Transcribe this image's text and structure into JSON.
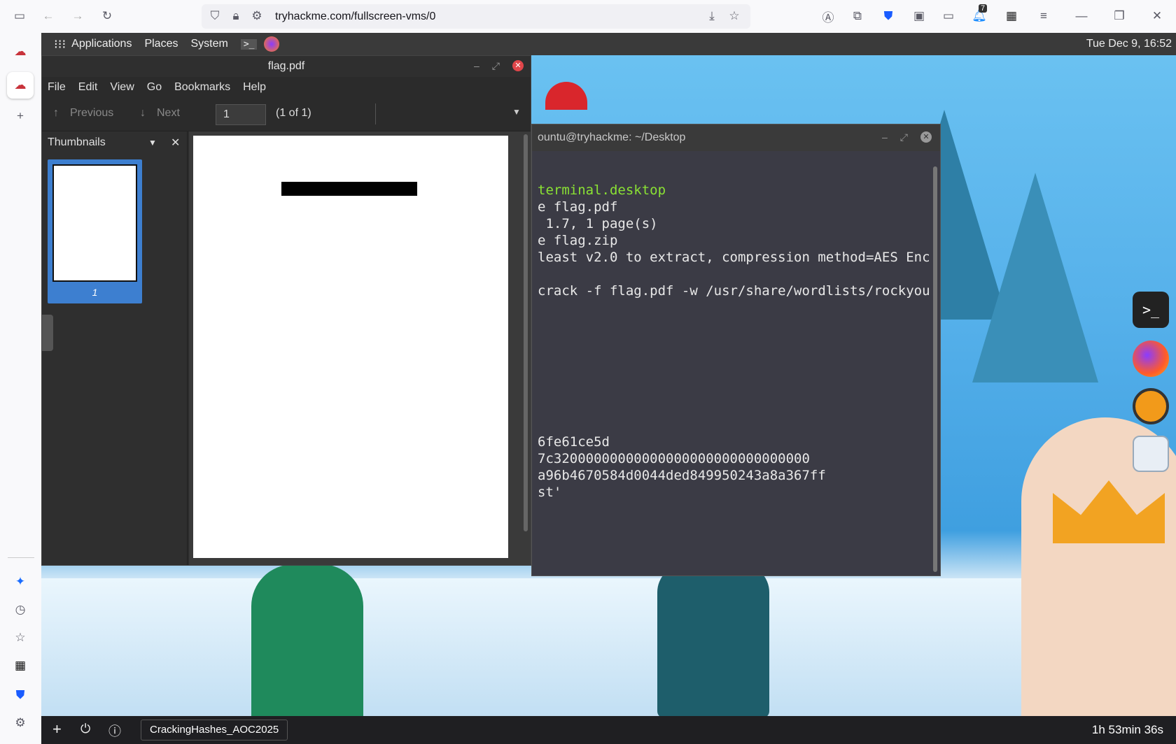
{
  "browser": {
    "url": "tryhackme.com/fullscreen-vms/0",
    "notification_count": "7"
  },
  "gnome_panel": {
    "applications": "Applications",
    "places": "Places",
    "system": "System",
    "clock": "Tue Dec 9, 16:52"
  },
  "pdf_viewer": {
    "title": "flag.pdf",
    "menu": [
      "File",
      "Edit",
      "View",
      "Go",
      "Bookmarks",
      "Help"
    ],
    "previous": "Previous",
    "next": "Next",
    "page_value": "1",
    "page_count": "(1 of 1)",
    "thumbnails_label": "Thumbnails",
    "thumb_page_number": "1"
  },
  "terminal": {
    "title": "ountu@tryhackme: ~/Desktop",
    "lines": [
      "terminal.desktop",
      "e flag.pdf",
      " 1.7, 1 page(s)",
      "e flag.zip",
      "least v2.0 to extract, compression method=AES Enc",
      "",
      "crack -f flag.pdf -w /usr/share/wordlists/rockyou",
      "6fe61ce5d",
      "7c32000000000000000000000000000000",
      "a96b4670584d0044ded849950243a8a367ff",
      "st'"
    ]
  },
  "bottom_bar": {
    "vm_name": "CrackingHashes_AOC2025",
    "timer": "1h 53min 36s"
  }
}
